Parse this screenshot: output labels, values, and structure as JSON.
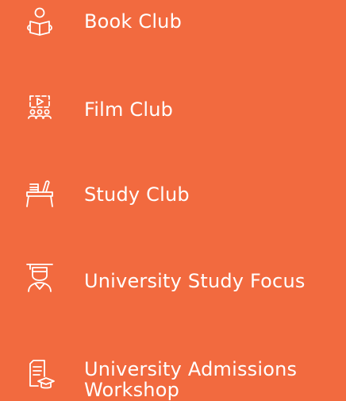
{
  "theme": {
    "background": "#f26a3f",
    "foreground": "#ffffff"
  },
  "menu": {
    "items": [
      {
        "label": "Book Club",
        "icon": "reader-icon"
      },
      {
        "label": "Film Club",
        "icon": "film-audience-icon"
      },
      {
        "label": "Study Club",
        "icon": "study-desk-icon"
      },
      {
        "label": "University Study Focus",
        "icon": "graduate-icon"
      },
      {
        "label_line1": "University Admissions",
        "label_line2": "Workshop",
        "icon": "document-graduation-icon"
      }
    ]
  }
}
